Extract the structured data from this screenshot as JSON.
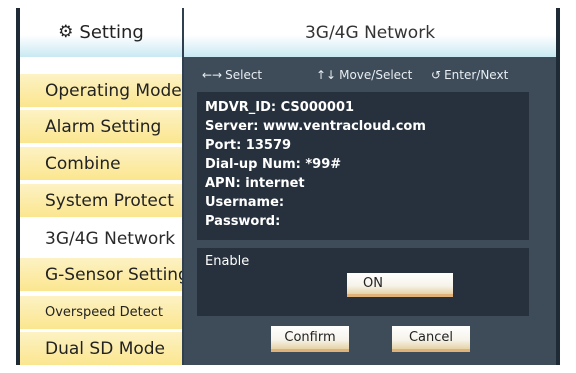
{
  "sidebar": {
    "header_icon": "gear-icon",
    "header_title": "Setting",
    "items": [
      {
        "label": "Operating Mode"
      },
      {
        "label": "Alarm Setting"
      },
      {
        "label": "Combine"
      },
      {
        "label": "System Protect"
      },
      {
        "label": "3G/4G Network",
        "active": true
      },
      {
        "label": "G-Sensor Setting"
      },
      {
        "label": "Overspeed Detect"
      },
      {
        "label": "Dual SD Mode"
      }
    ]
  },
  "main": {
    "title": "3G/4G Network",
    "hints": {
      "select_glyph": "←→",
      "select": "Select",
      "move_glyph": "↑↓",
      "move": "Move/Select",
      "enter_glyph": "↺",
      "enter": "Enter/Next"
    },
    "info": [
      "MDVR_ID:  CS000001",
      "Server:  www.ventracloud.com",
      "Port:  13579",
      "Dial-up Num:  *99#",
      "APN:  internet",
      "Username:",
      "Password:"
    ],
    "enable_label": "Enable",
    "enable_value": "ON",
    "confirm_label": "Confirm",
    "cancel_label": "Cancel"
  },
  "colors": {
    "panel": "#3e4b58",
    "inner_panel": "#26313d",
    "nav_item": "#fbe68f",
    "header_tint": "#c9e9f3"
  }
}
